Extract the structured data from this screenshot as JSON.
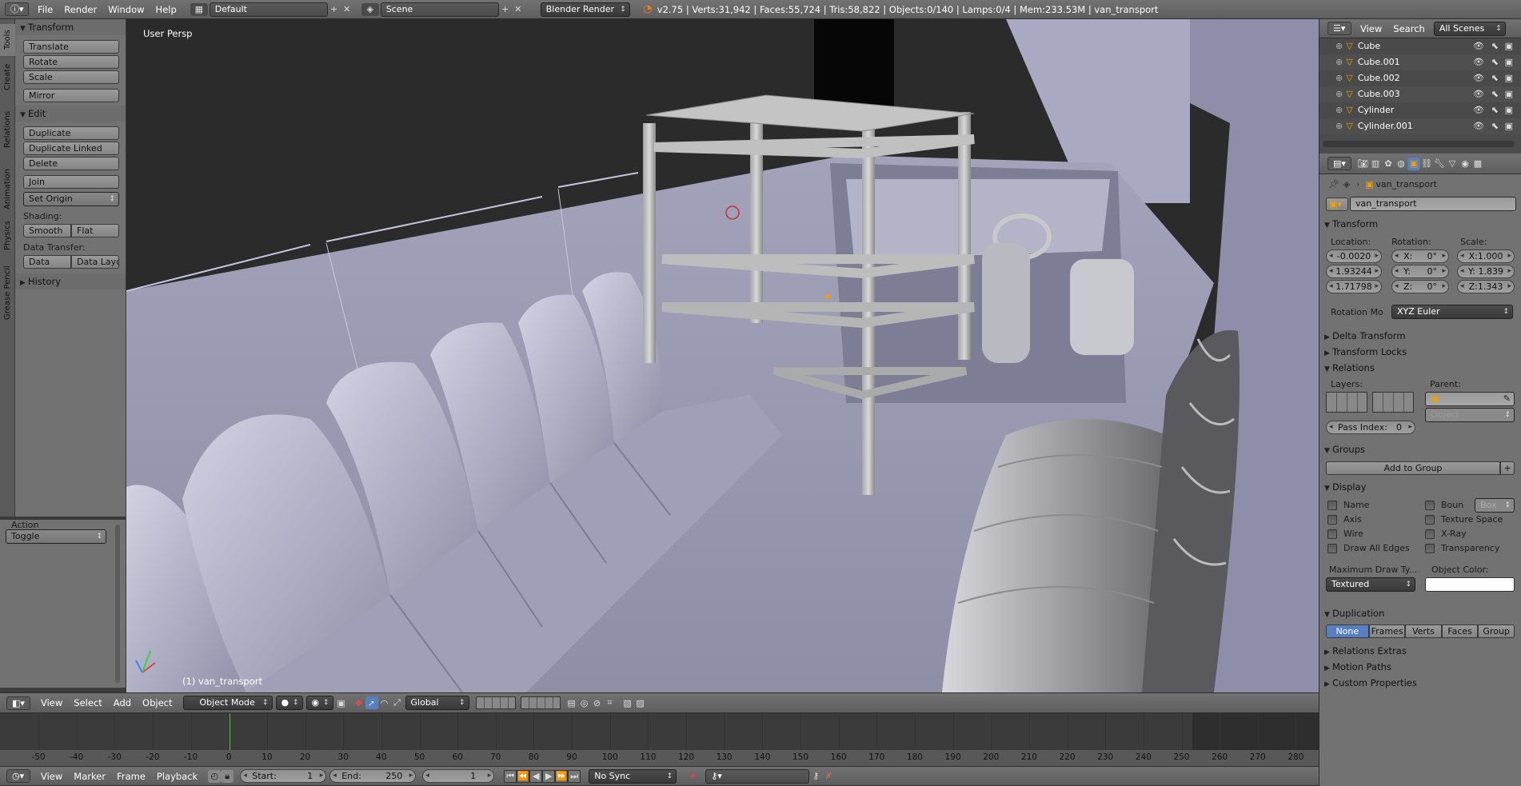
{
  "info_bar": {
    "menus": [
      "File",
      "Render",
      "Window",
      "Help"
    ],
    "screen_layout": "Default",
    "scene": "Scene",
    "engine": "Blender Render",
    "stats": "v2.75 | Verts:31,942 | Faces:55,724 | Tris:58,822 | Objects:0/140 | Lamps:0/4 | Mem:233.53M | van_transport"
  },
  "tool_tabs": [
    "Tools",
    "Create",
    "Relations",
    "Animation",
    "Physics",
    "Grease Pencil"
  ],
  "tool_shelf": {
    "transform_title": "Transform",
    "translate": "Translate",
    "rotate": "Rotate",
    "scale": "Scale",
    "mirror": "Mirror",
    "edit_title": "Edit",
    "duplicate": "Duplicate",
    "duplicate_linked": "Duplicate Linked",
    "delete": "Delete",
    "join": "Join",
    "set_origin": "Set Origin",
    "shading_label": "Shading:",
    "smooth": "Smooth",
    "flat": "Flat",
    "data_transfer_label": "Data Transfer:",
    "data": "Data",
    "data_layo": "Data Layo",
    "history_title": "History"
  },
  "operator_panel": {
    "title": "Action",
    "value": "Toggle"
  },
  "viewport": {
    "view_name": "User Persp",
    "object_label": "(1) van_transport"
  },
  "view3d_header": {
    "menus": [
      "View",
      "Select",
      "Add",
      "Object"
    ],
    "mode": "Object Mode",
    "orientation": "Global"
  },
  "timeline": {
    "ticks": [
      "-50",
      "-40",
      "-30",
      "-20",
      "-10",
      "0",
      "10",
      "20",
      "30",
      "40",
      "50",
      "60",
      "70",
      "80",
      "90",
      "100",
      "110",
      "120",
      "130",
      "140",
      "150",
      "160",
      "170",
      "180",
      "190",
      "200",
      "210",
      "220",
      "230",
      "240",
      "250",
      "260",
      "270",
      "280"
    ],
    "current_frame": "1"
  },
  "timeline_header": {
    "menus": [
      "View",
      "Marker",
      "Frame",
      "Playback"
    ],
    "start_label": "Start:",
    "start": "1",
    "end_label": "End:",
    "end": "250",
    "frame": "1",
    "sync": "No Sync"
  },
  "outliner": {
    "view": "View",
    "search": "Search",
    "scenes": "All Scenes",
    "items": [
      "Cube",
      "Cube.001",
      "Cube.002",
      "Cube.003",
      "Cylinder",
      "Cylinder.001"
    ]
  },
  "properties": {
    "breadcrumb": "van_transport",
    "object_name": "van_transport",
    "transform": {
      "title": "Transform",
      "location_label": "Location:",
      "rotation_label": "Rotation:",
      "scale_label": "Scale:",
      "location": [
        "-0.0020",
        "1.93244",
        "1.71798"
      ],
      "rotation": [
        "X:",
        "0°",
        "Y:",
        "0°",
        "Z:",
        "0°"
      ],
      "scale": [
        "X:1.000",
        "Y: 1.839",
        "Z:1.343"
      ],
      "rotation_mode_label": "Rotation Mo",
      "rotation_mode": "XYZ Euler"
    },
    "delta_title": "Delta Transform",
    "locks_title": "Transform Locks",
    "relations_title": "Relations",
    "layers_label": "Layers:",
    "parent_label": "Parent:",
    "parent_type": "Object",
    "pass_index_label": "Pass Index:",
    "pass_index": "0",
    "groups_title": "Groups",
    "add_to_group": "Add to Group",
    "display_title": "Display",
    "display_left": [
      "Name",
      "Axis",
      "Wire",
      "Draw All Edges"
    ],
    "display_right": [
      "Boun",
      "Texture Space",
      "X-Ray",
      "Transparency"
    ],
    "bounds_type": "Box",
    "max_draw_label": "Maximum Draw Ty...",
    "max_draw": "Textured",
    "object_color_label": "Object Color:",
    "duplication_title": "Duplication",
    "duplication_options": [
      "None",
      "Frames",
      "Verts",
      "Faces",
      "Group"
    ],
    "relations_extras": "Relations Extras",
    "motion_paths": "Motion Paths",
    "custom_properties": "Custom Properties"
  }
}
